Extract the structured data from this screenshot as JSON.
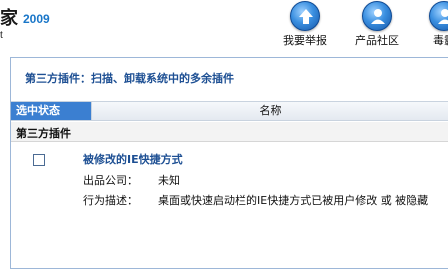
{
  "header": {
    "brand_char": "家",
    "brand_year": "2009",
    "brand_sub": "t",
    "nav": [
      {
        "label": "我要举报",
        "icon": "upload-arrow-icon"
      },
      {
        "label": "产品社区",
        "icon": "community-people-icon"
      },
      {
        "label": "毒霸",
        "icon": "antivirus-icon"
      }
    ]
  },
  "panel": {
    "title": "第三方插件：扫描、卸载系统中的多余插件",
    "columns": {
      "state": "选中状态",
      "name": "名称"
    },
    "group": "第三方插件",
    "item": {
      "title": "被修改的IE快捷方式",
      "company_label": "出品公司：",
      "company_value": "未知",
      "behavior_label": "行为描述：",
      "behavior_value": "桌面或快速启动栏的IE快捷方式已被用户修改 或 被隐藏",
      "checked": false
    }
  },
  "colors": {
    "accent": "#3b7fd1",
    "title_blue": "#1d4f93",
    "brand_blue": "#1976c8"
  }
}
